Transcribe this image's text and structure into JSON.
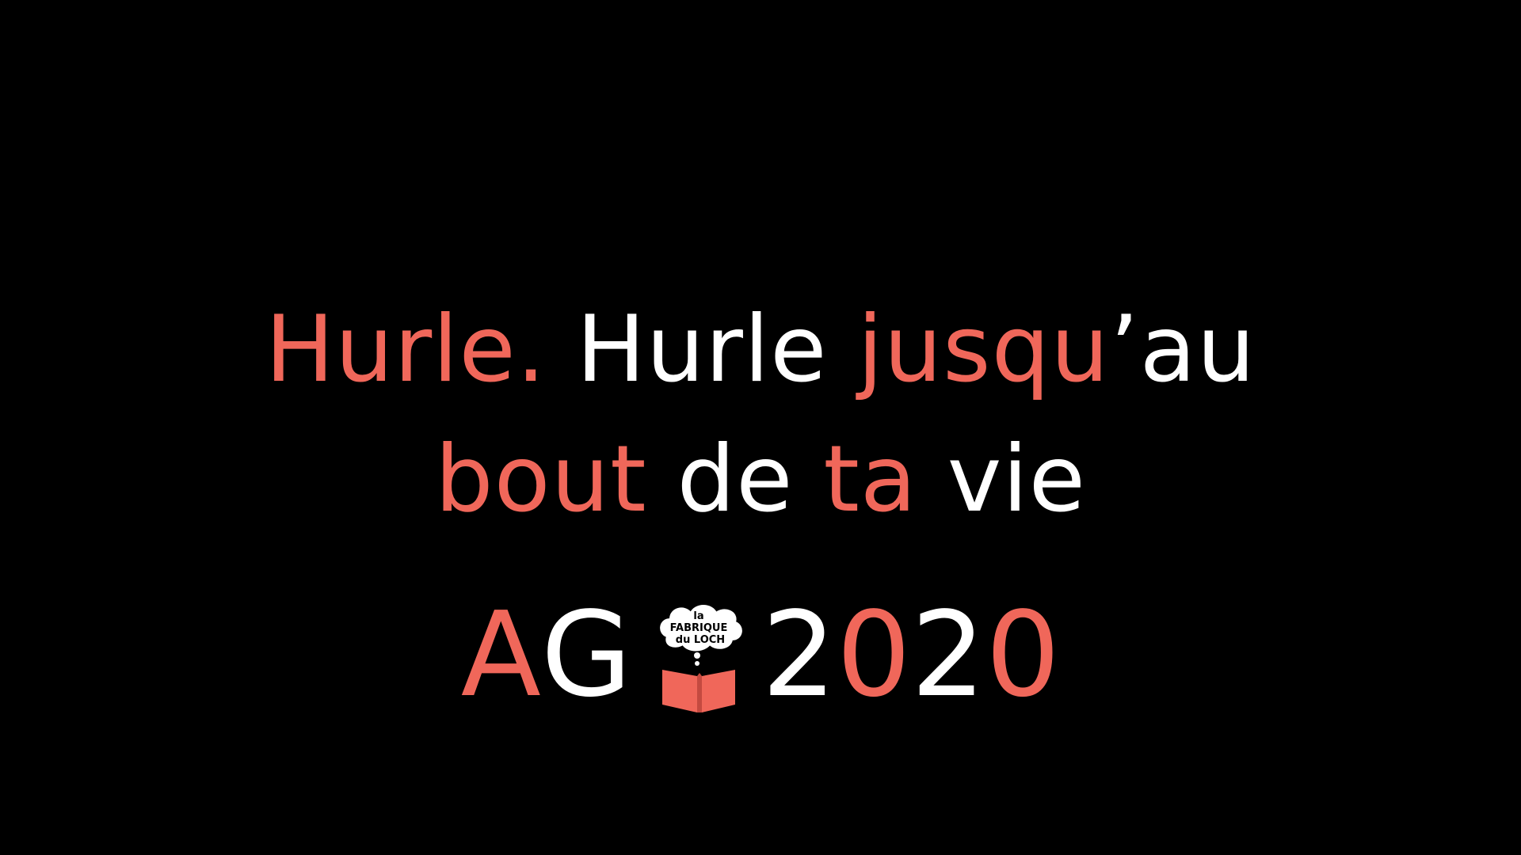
{
  "colors": {
    "background": "#000000",
    "accent": "#f0675a",
    "text": "#ffffff"
  },
  "quote": {
    "line1": [
      {
        "text": "Hurle.",
        "color": "salmon"
      },
      {
        "text": " Hurle ",
        "color": "white"
      },
      {
        "text": "jusqu",
        "color": "salmon"
      },
      {
        "text": "’au",
        "color": "white"
      }
    ],
    "line2": [
      {
        "text": "bout",
        "color": "salmon"
      },
      {
        "text": " de ",
        "color": "white"
      },
      {
        "text": "ta",
        "color": "salmon"
      },
      {
        "text": " vie",
        "color": "white"
      }
    ]
  },
  "title": {
    "part_a": "A",
    "part_g": "G",
    "year_2a": "2",
    "year_0a": "0",
    "year_2b": "2",
    "year_0b": "0"
  },
  "logo": {
    "icon": "book-thought-cloud-icon",
    "line1": "la",
    "line2": "FABRIQUE",
    "line3": "du LOCH"
  }
}
